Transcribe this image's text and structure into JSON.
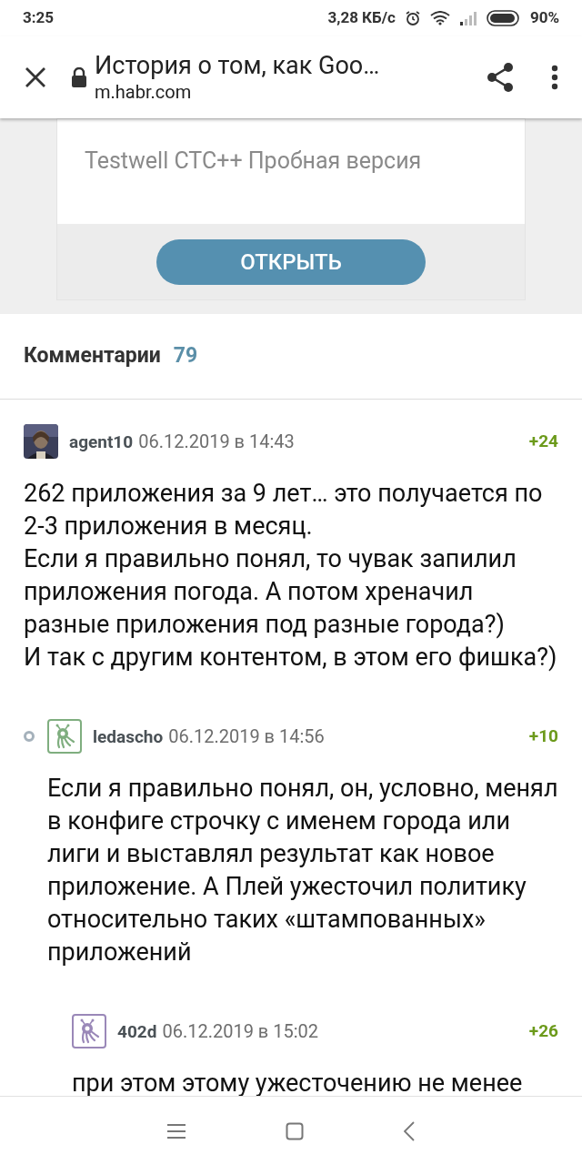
{
  "status_bar": {
    "time": "3:25",
    "speed": "3,28 КБ/с",
    "battery": "90%"
  },
  "browser_bar": {
    "title": "История о том, как Goo…",
    "url": "m.habr.com"
  },
  "ad": {
    "text": "Testwell CTC++ Пробная версия",
    "button": "ОТКРЫТЬ"
  },
  "comments_header": {
    "title": "Комментарии",
    "count": "79"
  },
  "comments": [
    {
      "author": "agent10",
      "date": "06.12.2019 в 14:43",
      "score": "+24",
      "paragraphs": [
        "262 приложения за 9 лет… это получается по 2-3 приложения в месяц.",
        "Если я правильно понял, то чувак запилил приложения погода. А потом хреначил разные приложения под разные города?)",
        "И так с другим контентом, в этом его фишка?)"
      ],
      "children": [
        {
          "author": "ledascho",
          "date": "06.12.2019 в 14:56",
          "score": "+10",
          "avatar": {
            "kind": "default",
            "color": "#7fae7f"
          },
          "paragraphs": [
            "Если я правильно понял, он, условно, менял в конфиге строчку с именем города или лиги и выставлял результат как новое приложение. А Плей ужесточил политику относительно таких «штампованных» приложений"
          ],
          "children": [
            {
              "author": "402d",
              "date": "06.12.2019 в 15:02",
              "score": "+26",
              "avatar": {
                "kind": "default",
                "color": "#9a88b8"
              },
              "paragraphs": [
                "при этом этому ужесточению не менее"
              ]
            }
          ]
        }
      ]
    }
  ]
}
